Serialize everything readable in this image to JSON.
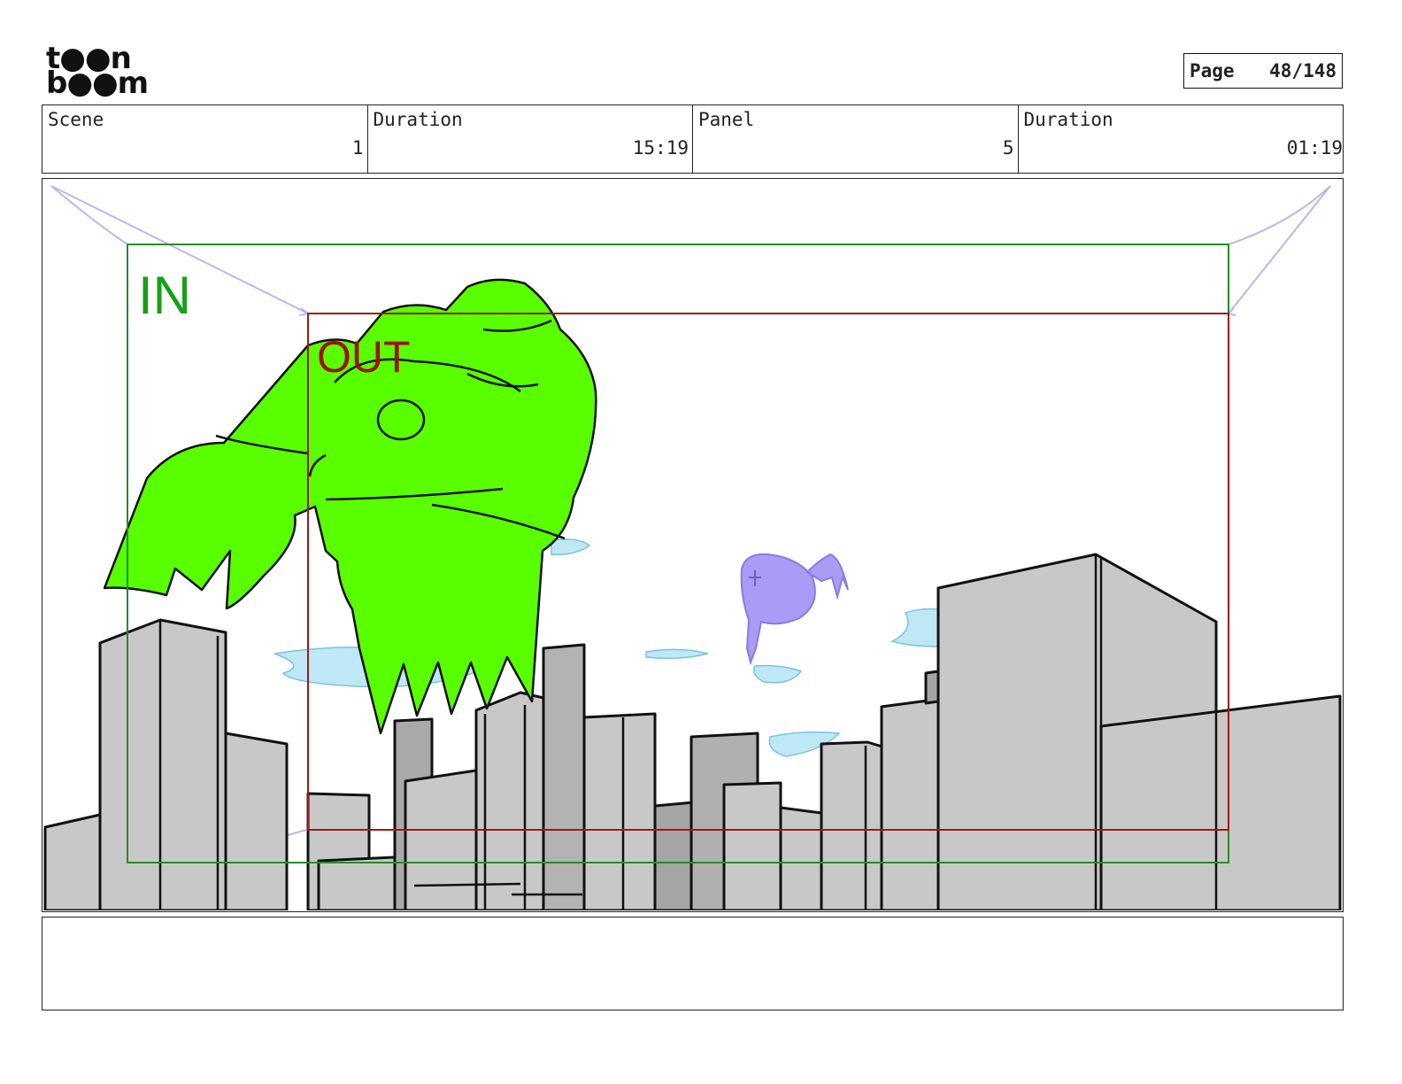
{
  "logo": {
    "line1": "t●●n",
    "line2": "b●●m",
    "text": "toonboom"
  },
  "page": {
    "label": "Page",
    "value": "48/148"
  },
  "info": {
    "scene_label": "Scene",
    "scene_value": "1",
    "scene_duration_label": "Duration",
    "scene_duration_value": "15:19",
    "panel_label": "Panel",
    "panel_value": "5",
    "panel_duration_label": "Duration",
    "panel_duration_value": "01:19"
  },
  "frames": {
    "in_label": "IN",
    "out_label": "OUT",
    "in_color": "#2a8a2a",
    "out_color": "#a01818"
  },
  "colors": {
    "robot": "#59ff00",
    "creature": "#a99cf5",
    "clouds": "#bfe8f6",
    "buildings": "#c8c8c8",
    "camera_arrows": "#b9b7ee"
  },
  "notes": {
    "text": ""
  }
}
